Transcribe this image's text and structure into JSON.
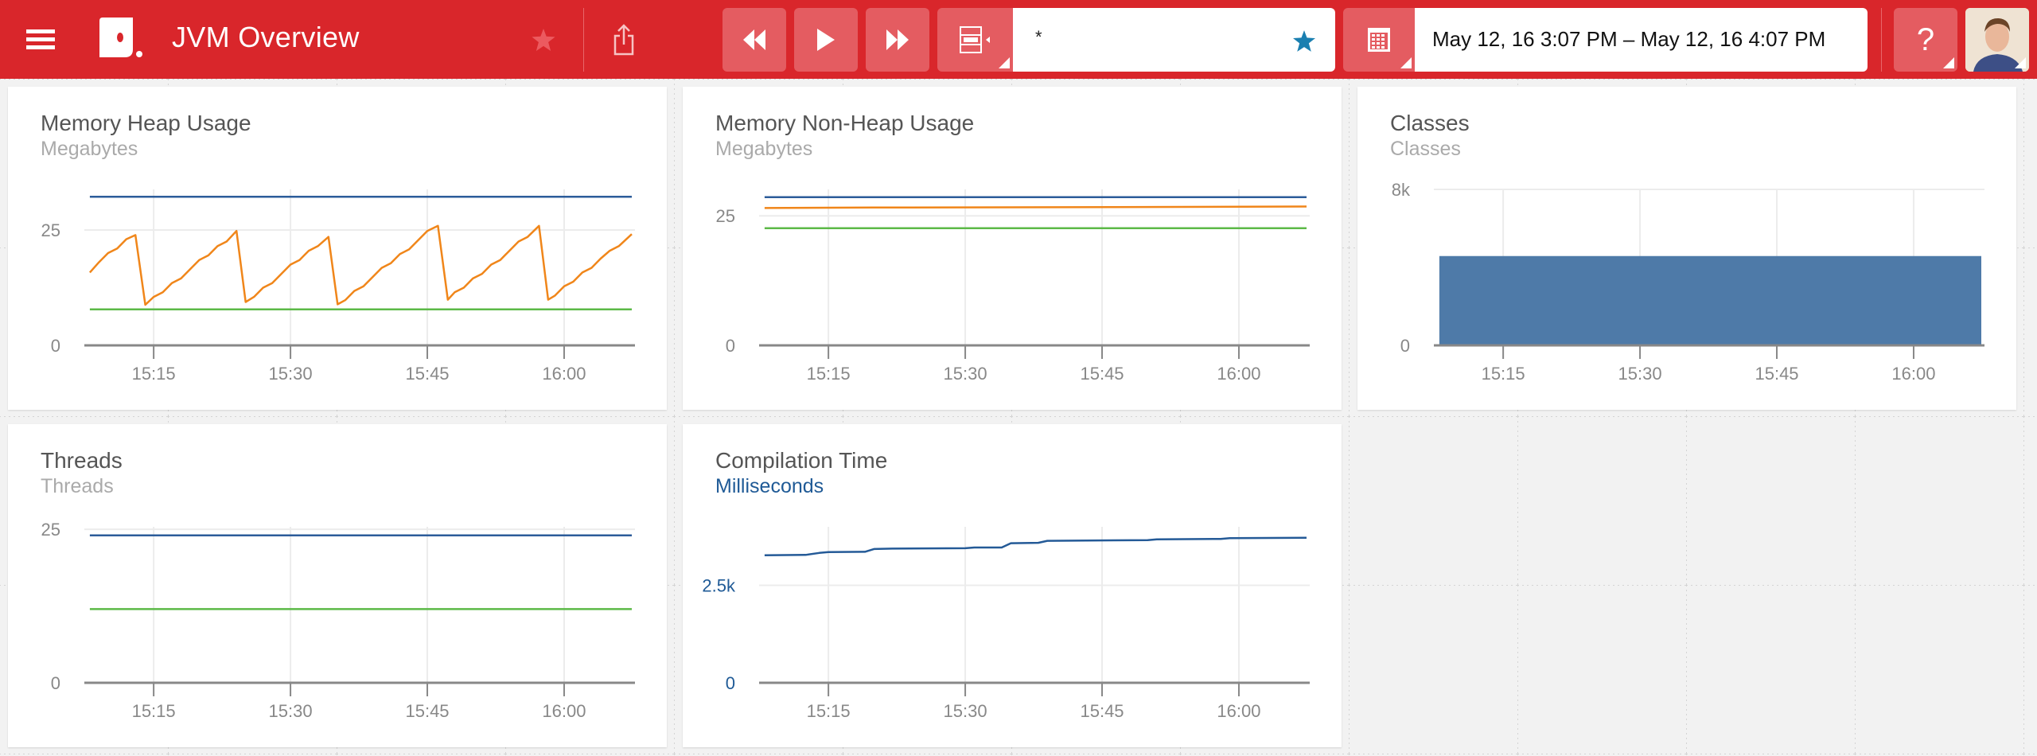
{
  "header": {
    "title": "JVM Overview",
    "icons": {
      "menu": "hamburger-icon",
      "logo": "app-logo",
      "favorite": "star-icon",
      "share": "share-icon",
      "rewind": "rewind-icon",
      "play": "play-icon",
      "fast_forward": "fast-forward-icon",
      "layout": "layout-icon",
      "calendar": "calendar-icon",
      "help": "question-icon"
    },
    "search_value": "*",
    "date_range": "May 12, 16 3:07 PM – May 12, 16 4:07 PM",
    "help_label": "?",
    "colors": {
      "bar": "#d9262b",
      "button": "#e45c61",
      "search_star": "#1a7fb0"
    }
  },
  "chart_data": [
    {
      "type": "line",
      "title": "Memory Heap Usage",
      "subtitle": "Megabytes",
      "xlim": [
        "15:07:24",
        "16:07:46"
      ],
      "ylim": [
        0,
        33.8
      ],
      "xticks": [
        "15:15",
        "15:30",
        "15:45",
        "16:00"
      ],
      "yticks": [
        {
          "value": 0,
          "label": "0"
        },
        {
          "value": 25,
          "label": "25"
        }
      ],
      "series": [
        {
          "color": "#2c5c9a",
          "x": [
            "15:08:00",
            "16:07:25"
          ],
          "y": [
            32.2,
            32.2
          ]
        },
        {
          "color": "#f0861a",
          "x": [
            "15:08:00",
            "15:09:00",
            "15:10:00",
            "15:11:00",
            "15:12:00",
            "15:13:00",
            "15:14:05",
            "15:15:00",
            "15:16:00",
            "15:17:00",
            "15:18:00",
            "15:19:00",
            "15:20:00",
            "15:21:00",
            "15:22:00",
            "15:23:00",
            "15:24:05",
            "15:25:05",
            "15:26:00",
            "15:27:00",
            "15:28:00",
            "15:29:00",
            "15:30:00",
            "15:31:00",
            "15:32:00",
            "15:33:00",
            "15:34:10",
            "15:35:10",
            "15:36:00",
            "15:37:00",
            "15:38:00",
            "15:39:00",
            "15:40:00",
            "15:41:00",
            "15:42:00",
            "15:43:00",
            "15:44:00",
            "15:45:00",
            "15:46:10",
            "15:47:15",
            "15:48:00",
            "15:49:00",
            "15:50:00",
            "15:51:00",
            "15:52:00",
            "15:53:00",
            "15:54:00",
            "15:55:00",
            "15:56:00",
            "15:57:15",
            "15:58:15",
            "15:59:00",
            "16:00:00",
            "16:01:00",
            "16:02:00",
            "16:03:00",
            "16:04:00",
            "16:05:00",
            "16:06:00",
            "16:07:25"
          ],
          "y": [
            15.8,
            18,
            20,
            21,
            23,
            23.9,
            8.8,
            10.5,
            11.5,
            13.5,
            14.5,
            16.5,
            18.5,
            19.5,
            21.5,
            22.5,
            24.8,
            9.4,
            10.5,
            12.5,
            13.5,
            15.5,
            17.5,
            18.5,
            20.5,
            21.5,
            23.5,
            8.9,
            9.8,
            11.8,
            12.8,
            14.8,
            16.8,
            17.8,
            19.8,
            20.8,
            22.8,
            24.8,
            25.9,
            9.9,
            11.5,
            12.5,
            14.5,
            15.5,
            17.5,
            18.5,
            20.5,
            22.5,
            23.5,
            25.9,
            9.9,
            10.8,
            12.8,
            13.8,
            15.8,
            16.8,
            18.8,
            20.5,
            21.5,
            24.1
          ]
        },
        {
          "color": "#5cb947",
          "x": [
            "15:08:00",
            "16:07:25"
          ],
          "y": [
            7.8,
            7.8
          ]
        }
      ]
    },
    {
      "type": "line",
      "title": "Memory Non-Heap Usage",
      "subtitle": "Megabytes",
      "xlim": [
        "15:07:24",
        "16:07:46"
      ],
      "ylim": [
        0,
        30.1
      ],
      "xticks": [
        "15:15",
        "15:30",
        "15:45",
        "16:00"
      ],
      "yticks": [
        {
          "value": 0,
          "label": "0"
        },
        {
          "value": 25,
          "label": "25"
        }
      ],
      "series": [
        {
          "color": "#2c5c9a",
          "x": [
            "15:08:00",
            "16:07:25"
          ],
          "y": [
            28.6,
            28.6
          ]
        },
        {
          "color": "#f0861a",
          "x": [
            "15:08:00",
            "15:20:00",
            "15:35:00",
            "15:50:00",
            "16:07:25"
          ],
          "y": [
            26.5,
            26.6,
            26.65,
            26.7,
            26.8
          ]
        },
        {
          "color": "#5cb947",
          "x": [
            "15:08:00",
            "16:07:25"
          ],
          "y": [
            22.6,
            22.6
          ]
        }
      ]
    },
    {
      "type": "area",
      "title": "Classes",
      "subtitle": "Classes",
      "xlim": [
        "15:07:24",
        "16:07:46"
      ],
      "ylim": [
        0,
        8000
      ],
      "xticks": [
        "15:15",
        "15:30",
        "15:45",
        "16:00"
      ],
      "yticks": [
        {
          "value": 0,
          "label": "0"
        },
        {
          "value": 8000,
          "label": "8k"
        }
      ],
      "series": [
        {
          "color": "#4e7aa8",
          "x": [
            "15:08:00",
            "16:07:25"
          ],
          "y": [
            4580,
            4580
          ]
        }
      ]
    },
    {
      "type": "line",
      "title": "Threads",
      "subtitle": "Threads",
      "xlim": [
        "15:07:24",
        "16:07:46"
      ],
      "ylim": [
        0,
        25.4
      ],
      "xticks": [
        "15:15",
        "15:30",
        "15:45",
        "16:00"
      ],
      "yticks": [
        {
          "value": 0,
          "label": "0"
        },
        {
          "value": 25,
          "label": "25"
        }
      ],
      "series": [
        {
          "color": "#2c5c9a",
          "x": [
            "15:08:00",
            "16:07:25"
          ],
          "y": [
            24,
            24
          ]
        },
        {
          "color": "#5cb947",
          "x": [
            "15:08:00",
            "16:07:25"
          ],
          "y": [
            12,
            12
          ]
        }
      ]
    },
    {
      "type": "line",
      "title": "Compilation Time",
      "subtitle": "Milliseconds",
      "subtitle_color": "#1f5a96",
      "ytick_color": "#1f5a96",
      "xlim": [
        "15:07:24",
        "16:07:46"
      ],
      "ylim": [
        0,
        4000
      ],
      "xticks": [
        "15:15",
        "15:30",
        "15:45",
        "16:00"
      ],
      "yticks": [
        {
          "value": 0,
          "label": "0"
        },
        {
          "value": 2500,
          "label": "2.5k"
        }
      ],
      "series": [
        {
          "color": "#245a97",
          "x": [
            "15:08:00",
            "15:12:30",
            "15:14:00",
            "15:15:00",
            "15:19:00",
            "15:20:00",
            "15:22:00",
            "15:30:00",
            "15:31:00",
            "15:34:00",
            "15:35:00",
            "15:38:00",
            "15:39:00",
            "15:50:00",
            "15:51:00",
            "15:58:00",
            "15:59:00",
            "16:07:25"
          ],
          "y": [
            3270,
            3280,
            3330,
            3350,
            3360,
            3430,
            3440,
            3450,
            3470,
            3470,
            3580,
            3590,
            3640,
            3660,
            3680,
            3690,
            3710,
            3720
          ]
        }
      ]
    }
  ]
}
